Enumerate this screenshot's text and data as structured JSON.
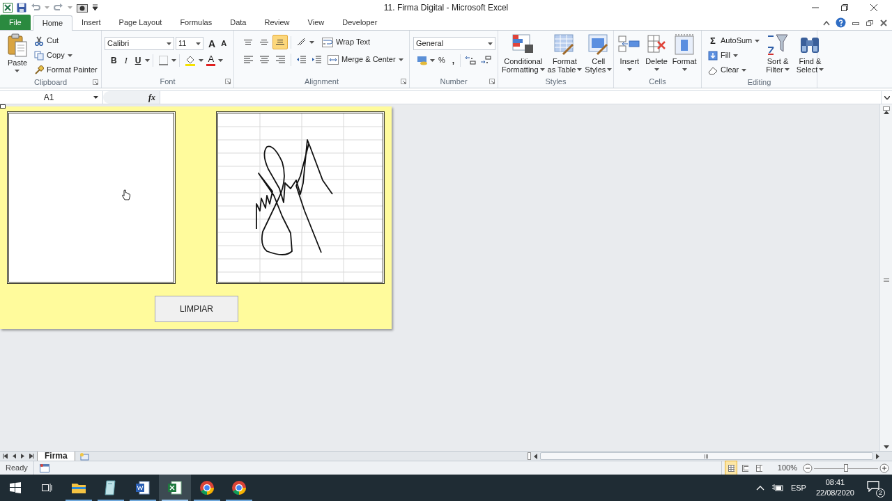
{
  "title_bar": {
    "title": "11. Firma Digital - Microsoft Excel"
  },
  "ribbon_tabs": [
    {
      "label": "File",
      "kind": "file",
      "selected": false
    },
    {
      "label": "Home",
      "kind": "tab",
      "selected": true
    },
    {
      "label": "Insert",
      "kind": "tab",
      "selected": false
    },
    {
      "label": "Page Layout",
      "kind": "tab",
      "selected": false
    },
    {
      "label": "Formulas",
      "kind": "tab",
      "selected": false
    },
    {
      "label": "Data",
      "kind": "tab",
      "selected": false
    },
    {
      "label": "Review",
      "kind": "tab",
      "selected": false
    },
    {
      "label": "View",
      "kind": "tab",
      "selected": false
    },
    {
      "label": "Developer",
      "kind": "tab",
      "selected": false
    }
  ],
  "ribbon": {
    "clipboard": {
      "label": "Clipboard",
      "paste": "Paste",
      "cut": "Cut",
      "copy": "Copy",
      "format_painter": "Format Painter"
    },
    "font": {
      "label": "Font",
      "font_name": "Calibri",
      "font_size": "11",
      "grow": "A",
      "shrink": "A",
      "bold": "B",
      "italic": "I",
      "underline": "U",
      "font_color": "A"
    },
    "alignment": {
      "label": "Alignment",
      "wrap_text": "Wrap Text",
      "merge_center": "Merge & Center",
      "vertical_align": [
        {
          "kind": "top",
          "selected": false
        },
        {
          "kind": "middle",
          "selected": false
        },
        {
          "kind": "bottom",
          "selected": true
        }
      ]
    },
    "number": {
      "label": "Number",
      "format": "General",
      "percent": "%",
      "comma": ","
    },
    "styles": {
      "label": "Styles",
      "buttons": [
        {
          "kind": "conditional",
          "lines": [
            "Conditional",
            "Formatting"
          ]
        },
        {
          "kind": "table",
          "lines": [
            "Format",
            "as Table"
          ]
        },
        {
          "kind": "cell",
          "lines": [
            "Cell",
            "Styles"
          ]
        }
      ]
    },
    "cells": {
      "label": "Cells",
      "buttons": [
        {
          "kind": "insert",
          "label": "Insert"
        },
        {
          "kind": "delete",
          "label": "Delete"
        },
        {
          "kind": "format",
          "label": "Format"
        }
      ]
    },
    "editing": {
      "label": "Editing",
      "autosum_symbol": "Σ",
      "autosum": "AutoSum",
      "fill": "Fill",
      "clear": "Clear",
      "buttons": [
        {
          "kind": "sort",
          "lines": [
            "Sort &",
            "Filter"
          ]
        },
        {
          "kind": "find",
          "lines": [
            "Find &",
            "Select"
          ]
        }
      ]
    }
  },
  "formula_bar": {
    "name_box": "A1",
    "fx": "fx"
  },
  "panel": {
    "boxes": [
      {
        "kind": "blank"
      },
      {
        "kind": "signature"
      }
    ],
    "button": "LIMPIAR"
  },
  "sheet_tabs": [
    {
      "label": "Firma",
      "selected": true
    }
  ],
  "status_bar": {
    "status": "Ready",
    "views": [
      {
        "kind": "normal",
        "selected": true
      },
      {
        "kind": "page_layout",
        "selected": false
      },
      {
        "kind": "page_break",
        "selected": false
      }
    ],
    "zoom": "100%",
    "zoom_slider": {
      "level": 0.5
    }
  },
  "taskbar": {
    "apps": [
      {
        "kind": "explorer",
        "selected": false
      },
      {
        "kind": "notes",
        "selected": false
      },
      {
        "kind": "word",
        "selected": false
      },
      {
        "kind": "excel",
        "selected": true
      },
      {
        "kind": "chrome",
        "selected": false
      },
      {
        "kind": "chrome",
        "selected": false
      }
    ],
    "language": "ESP",
    "time": "08:41",
    "date": "22/08/2020",
    "notifications": "2"
  }
}
